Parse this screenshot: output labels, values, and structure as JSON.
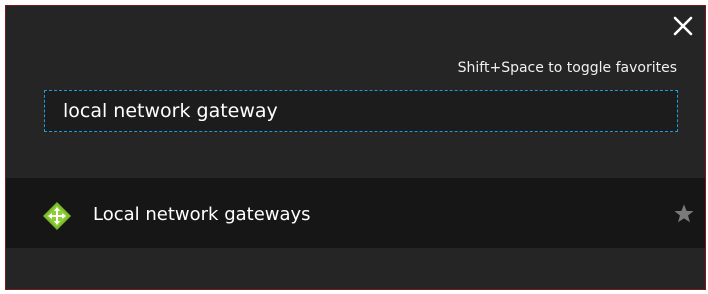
{
  "dialog": {
    "close_icon": "close-icon",
    "hint_text": "Shift+Space to toggle favorites",
    "search": {
      "value": "local network gateway",
      "placeholder": ""
    },
    "results": [
      {
        "label": "Local network gateways",
        "icon": "local-network-gateway-icon",
        "favorite_icon": "star-icon",
        "favorited": false
      }
    ]
  },
  "colors": {
    "background": "#252525",
    "result_row_background": "#161616",
    "search_border": "#1e9bd7",
    "icon_green": "#7cb928",
    "star_inactive": "#7a7a7a"
  }
}
